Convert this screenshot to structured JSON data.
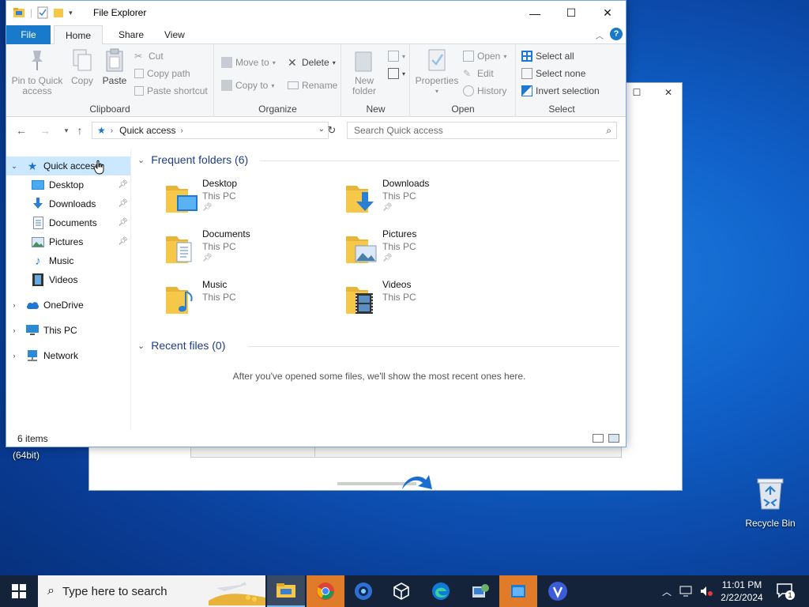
{
  "window": {
    "title": "File Explorer"
  },
  "ribbon_tabs": {
    "file": "File",
    "home": "Home",
    "share": "Share",
    "view": "View"
  },
  "ribbon": {
    "clipboard": {
      "label": "Clipboard",
      "pin": "Pin to Quick access",
      "copy": "Copy",
      "paste": "Paste",
      "cut": "Cut",
      "copy_path": "Copy path",
      "paste_shortcut": "Paste shortcut"
    },
    "organize": {
      "label": "Organize",
      "move_to": "Move to",
      "copy_to": "Copy to",
      "delete": "Delete",
      "rename": "Rename"
    },
    "new": {
      "label": "New",
      "new_folder": "New folder"
    },
    "open": {
      "label": "Open",
      "properties": "Properties",
      "open": "Open",
      "edit": "Edit",
      "history": "History"
    },
    "select": {
      "label": "Select",
      "select_all": "Select all",
      "select_none": "Select none",
      "invert": "Invert selection"
    }
  },
  "address": {
    "location": "Quick access",
    "search_placeholder": "Search Quick access"
  },
  "nav": {
    "quick_access": "Quick access",
    "desktop": "Desktop",
    "downloads": "Downloads",
    "documents": "Documents",
    "pictures": "Pictures",
    "music": "Music",
    "videos": "Videos",
    "onedrive": "OneDrive",
    "this_pc": "This PC",
    "network": "Network"
  },
  "content": {
    "frequent_header": "Frequent folders (6)",
    "recent_header": "Recent files (0)",
    "empty_message": "After you've opened some files, we'll show the most recent ones here.",
    "folders": [
      {
        "name": "Desktop",
        "location": "This PC",
        "pinned": true
      },
      {
        "name": "Downloads",
        "location": "This PC",
        "pinned": true
      },
      {
        "name": "Documents",
        "location": "This PC",
        "pinned": true
      },
      {
        "name": "Pictures",
        "location": "This PC",
        "pinned": true
      },
      {
        "name": "Music",
        "location": "This PC",
        "pinned": false
      },
      {
        "name": "Videos",
        "location": "This PC",
        "pinned": false
      }
    ]
  },
  "status": {
    "items": "6 items"
  },
  "desktop": {
    "partial_label": "(64bit)",
    "recycle_bin": "Recycle Bin"
  },
  "taskbar": {
    "search_placeholder": "Type here to search",
    "time": "11:01 PM",
    "date": "2/22/2024",
    "notification_count": "1"
  },
  "colors": {
    "accent": "#1979ca",
    "selection": "#cce8ff",
    "folder_yellow": "#f5c84a",
    "taskbar": "#15233a"
  }
}
